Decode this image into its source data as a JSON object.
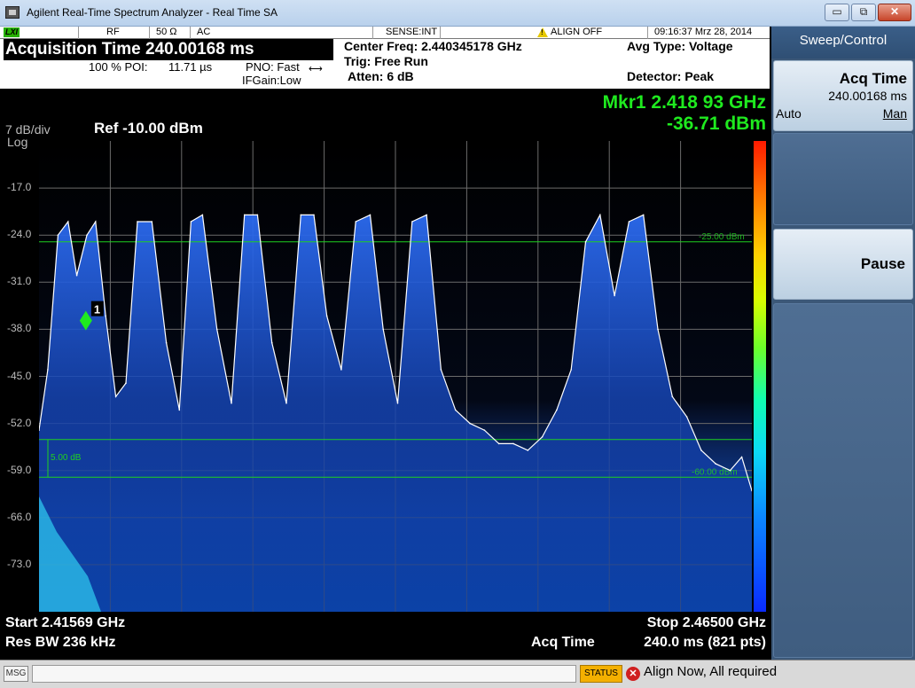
{
  "window": {
    "title": "Agilent Real-Time Spectrum Analyzer - Real Time SA",
    "minimize": "▭",
    "maximize": "⧉",
    "close": "✕"
  },
  "status_strip": {
    "lxi": "LXI",
    "rf": "RF",
    "impedance": "50 Ω",
    "coupling": "AC",
    "sense": "SENSE:INT",
    "align": "ALIGN OFF",
    "datetime": "09:16:37  Mrz 28, 2014"
  },
  "info_panel": {
    "acq_time_title": "Acquisition Time 240.00168 ms",
    "poi_label": "100 % POI:",
    "poi_value": "11.71 µs",
    "pno": "PNO: Fast",
    "ifgain": "IFGain:Low",
    "center_freq": "Center Freq: 2.440345178 GHz",
    "trig": "Trig: Free Run",
    "atten": "Atten: 6 dB",
    "avg_type": "Avg Type: Voltage",
    "detector": "Detector: Peak"
  },
  "display": {
    "scale": "7 dB/div",
    "log": "Log",
    "ref": "Ref -10.00 dBm",
    "marker_freq": "Mkr1 2.418 93 GHz",
    "marker_amp": "-36.71 dBm",
    "marker_label": "1",
    "threshold_line_label": "-25.00 dBm",
    "threshold_line2_label": "-60.00 dBm",
    "delta_label": "5.00 dB",
    "start": "Start 2.41569 GHz",
    "stop": "Stop 2.46500 GHz",
    "res_bw": "Res BW 236 kHz",
    "acq_time_label": "Acq Time",
    "acq_time_value": "240.0 ms (821 pts)",
    "colors": {
      "trace": "#ffffff",
      "marker": "#1fea1f",
      "limit_line": "#1fd01f"
    }
  },
  "chart_data": {
    "type": "line",
    "title": "",
    "xlabel": "",
    "ylabel": "",
    "xlim": [
      2.41569,
      2.465
    ],
    "ylim": [
      -80,
      -10
    ],
    "yticks": [
      "-17.0",
      "-24.0",
      "-31.0",
      "-38.0",
      "-45.0",
      "-52.0",
      "-59.0",
      "-66.0",
      "-73.0"
    ],
    "series": [
      {
        "x": [
          2.41569,
          2.4163,
          2.417,
          2.4177,
          2.4183,
          2.419,
          2.4196,
          2.4203,
          2.421,
          2.4217,
          2.4225,
          2.4235,
          2.4245,
          2.4254,
          2.4262,
          2.427,
          2.428,
          2.429,
          2.4299,
          2.4308,
          2.4318,
          2.4328,
          2.4338,
          2.4347,
          2.4356,
          2.4366,
          2.4376,
          2.4386,
          2.4395,
          2.4405,
          2.4415,
          2.4425,
          2.4435,
          2.4445,
          2.4455,
          2.4465,
          2.4475,
          2.4485,
          2.4495,
          2.4505,
          2.4515,
          2.4525,
          2.4535,
          2.4545,
          2.4555,
          2.4565,
          2.4575,
          2.4585,
          2.4595,
          2.4605,
          2.4615,
          2.4625,
          2.4635,
          2.4643,
          2.465
        ],
        "values": [
          -53,
          -44,
          -24,
          -22,
          -30,
          -24,
          -22,
          -36,
          -48,
          -46,
          -22,
          -22,
          -40,
          -50,
          -22,
          -21,
          -38,
          -49,
          -21,
          -21,
          -40,
          -49,
          -21,
          -21,
          -36,
          -44,
          -22,
          -21,
          -38,
          -49,
          -22,
          -21,
          -44,
          -50,
          -52,
          -53,
          -55,
          -55,
          -56,
          -54,
          -50,
          -44,
          -25,
          -21,
          -33,
          -22,
          -21,
          -38,
          -48,
          -51,
          -56,
          -58,
          -59,
          -57,
          -62
        ]
      }
    ],
    "markers": [
      {
        "label": "1",
        "x": 2.41893,
        "y": -36.71
      }
    ],
    "lines": [
      {
        "y": -25,
        "label": "-25.00 dBm"
      },
      {
        "y": -60,
        "label": "-60.00 dBm"
      }
    ]
  },
  "softkeys": {
    "panel_title": "Sweep/Control",
    "acq_time_title": "Acq Time",
    "acq_time_value": "240.00168 ms",
    "auto": "Auto",
    "man": "Man",
    "pause": "Pause"
  },
  "message_bar": {
    "msg": "MSG",
    "status": "STATUS",
    "align_msg": "Align Now, All required"
  }
}
